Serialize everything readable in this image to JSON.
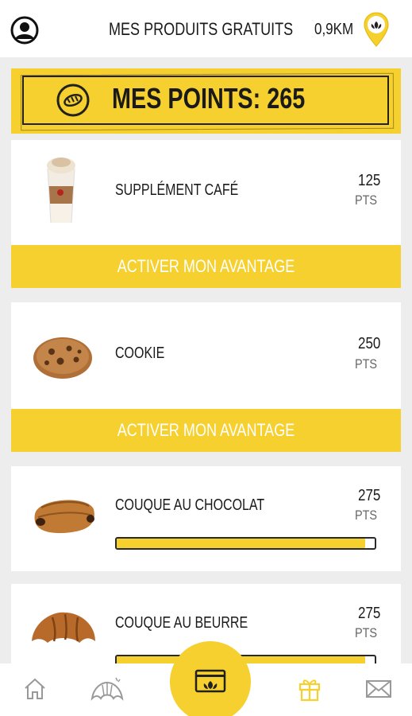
{
  "header": {
    "title": "MES PRODUITS GRATUITS",
    "distance": "0,9KM"
  },
  "points_banner": {
    "text": "MES POINTS: 265"
  },
  "products": [
    {
      "name": "SUPPLÉMENT CAFÉ",
      "points": "125",
      "unit": "PTS",
      "action": "ACTIVER MON AVANTAGE"
    },
    {
      "name": "COOKIE",
      "points": "250",
      "unit": "PTS",
      "action": "ACTIVER MON AVANTAGE"
    },
    {
      "name": "COUQUE AU CHOCOLAT",
      "points": "275",
      "unit": "PTS",
      "progress": 0.964
    },
    {
      "name": "COUQUE AU BEURRE",
      "points": "275",
      "unit": "PTS",
      "progress": 0.964
    }
  ],
  "nav": {
    "items": [
      "home-icon",
      "croissant-icon",
      "card-icon",
      "gift-icon",
      "mail-icon"
    ],
    "active": "card-icon"
  },
  "colors": {
    "accent": "#f6d02e",
    "text": "#1a1a1a",
    "background": "#ededed"
  }
}
